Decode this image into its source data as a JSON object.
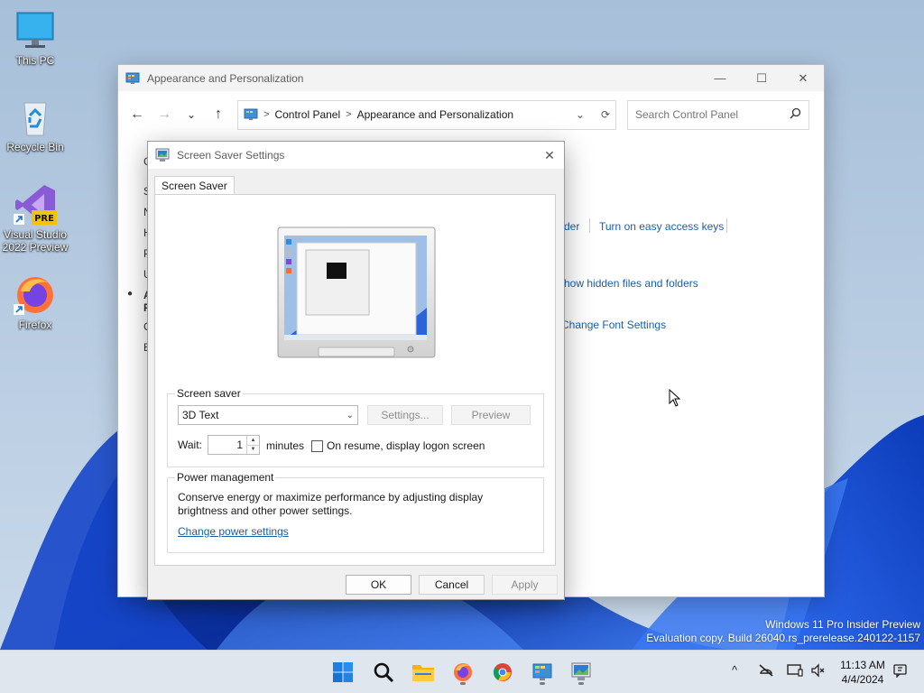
{
  "desktop": {
    "icons": [
      {
        "label": "This PC",
        "icon": "monitor-icon"
      },
      {
        "label": "Recycle Bin",
        "icon": "recycle-bin-icon"
      },
      {
        "label": "Visual Studio 2022 Preview",
        "icon": "visual-studio-icon",
        "badge": "PRE"
      },
      {
        "label": "Firefox",
        "icon": "firefox-icon"
      }
    ],
    "watermark": {
      "line1": "Windows 11 Pro Insider Preview",
      "line2": "Evaluation copy. Build 26040.rs_prerelease.240122-1157"
    }
  },
  "control_panel": {
    "title": "Appearance and Personalization",
    "window_buttons": {
      "minimize": "—",
      "maximize": "☐",
      "close": "✕"
    },
    "nav": {
      "back": "←",
      "forward": "→",
      "recent": "⌄",
      "up": "↑"
    },
    "address": {
      "crumbs": [
        "Control Panel",
        "Appearance and Personalization"
      ],
      "separator": ">"
    },
    "search": {
      "placeholder": "Search Control Panel"
    },
    "sidebar_letters": [
      "C",
      "S",
      "N",
      "H",
      "P",
      "U",
      "A",
      "F",
      "C",
      "E"
    ],
    "links": {
      "folder_partial": "der",
      "easy_access": "Turn on easy access keys",
      "hidden_files": "how hidden files and folders",
      "font_settings": "Change Font Settings"
    }
  },
  "screen_saver_dialog": {
    "title": "Screen Saver Settings",
    "close": "✕",
    "tab": "Screen Saver",
    "screen_saver_group": {
      "legend": "Screen saver",
      "selected": "3D Text",
      "settings_button": "Settings...",
      "preview_button": "Preview",
      "wait_label": "Wait:",
      "wait_value": "1",
      "minutes_label": "minutes",
      "resume_label": "On resume, display logon screen",
      "resume_checked": false
    },
    "power_group": {
      "legend": "Power management",
      "description_line1": "Conserve energy or maximize performance by adjusting display",
      "description_line2": "brightness and other power settings.",
      "link": "Change power settings"
    },
    "buttons": {
      "ok": "OK",
      "cancel": "Cancel",
      "apply": "Apply"
    }
  },
  "taskbar": {
    "apps": [
      "start-icon",
      "search-icon",
      "file-explorer-icon",
      "firefox-icon",
      "chrome-icon",
      "control-panel-icon",
      "screen-saver-icon"
    ],
    "tray": {
      "chevron": "^"
    },
    "clock": {
      "time": "11:13 AM",
      "date": "4/4/2024"
    }
  }
}
